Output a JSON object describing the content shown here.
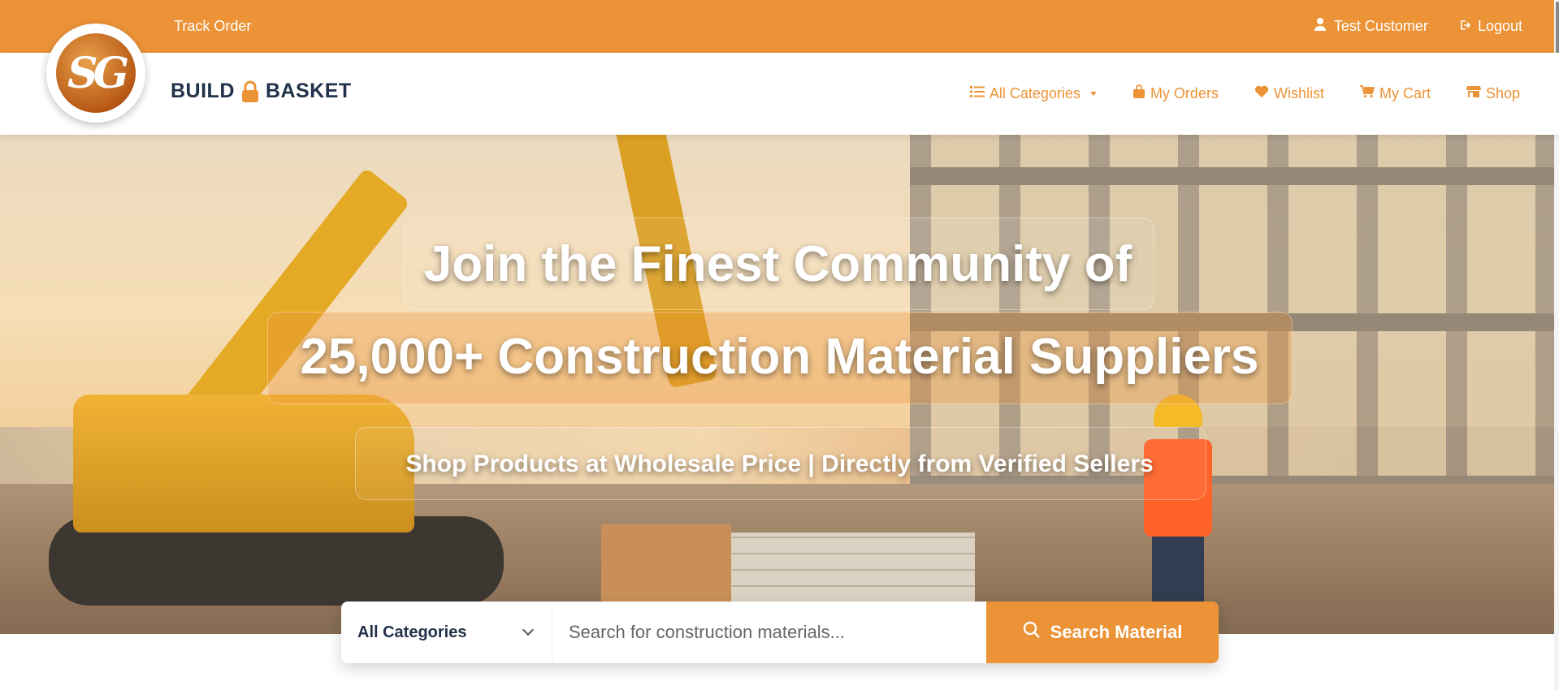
{
  "topbar": {
    "track_order": "Track Order",
    "user_name": "Test Customer",
    "logout": "Logout"
  },
  "brand": {
    "logo_text": "SG",
    "name_left": "BUILD",
    "name_right": "BASKET"
  },
  "nav": {
    "all_categories": "All Categories",
    "my_orders": "My Orders",
    "wishlist": "Wishlist",
    "my_cart": "My Cart",
    "shop": "Shop"
  },
  "hero": {
    "headline1": "Join the Finest Community of",
    "headline2": "25,000+ Construction Material Suppliers",
    "subheadline": "Shop Products at Wholesale Price | Directly from Verified Sellers"
  },
  "search": {
    "category_selected": "All Categories",
    "placeholder": "Search for construction materials...",
    "button": "Search Material"
  },
  "colors": {
    "accent": "#EC9337",
    "navy": "#22324a"
  }
}
